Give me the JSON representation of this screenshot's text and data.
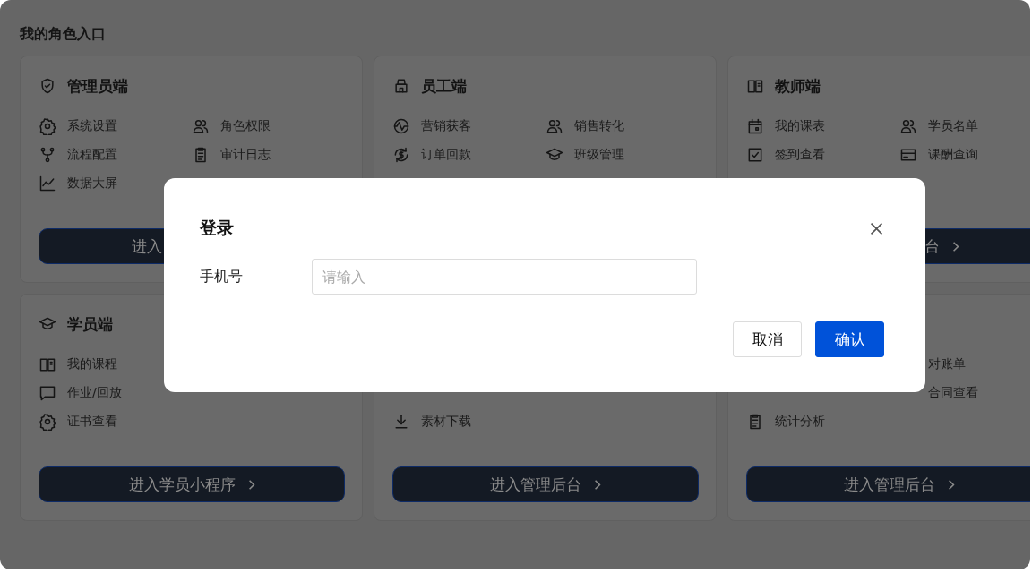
{
  "page_title": "我的角色入口",
  "cards": [
    {
      "title": "管理员端",
      "rows": [
        [
          {
            "label": "系统设置"
          },
          {
            "label": "角色权限"
          }
        ],
        [
          {
            "label": "流程配置"
          },
          {
            "label": "审计日志"
          }
        ],
        [
          {
            "label": "数据大屏"
          },
          null
        ]
      ],
      "button": {
        "label": "进入"
      }
    },
    {
      "title": "员工端",
      "rows": [
        [
          {
            "label": "营销获客"
          },
          {
            "label": "销售转化"
          }
        ],
        [
          {
            "label": "订单回款"
          },
          {
            "label": "班级管理"
          }
        ]
      ]
    },
    {
      "title": "教师端",
      "rows": [
        [
          {
            "label": "我的课表"
          },
          {
            "label": "学员名单"
          }
        ],
        [
          {
            "label": "签到查看"
          },
          {
            "label": "课酬查询"
          }
        ]
      ],
      "button": {
        "label": "台"
      }
    },
    {
      "title": "学员端",
      "rows": [
        [
          {
            "label": "我的课程"
          },
          null
        ],
        [
          {
            "label": "作业/回放"
          },
          null
        ],
        [
          {
            "label": "证书查看"
          },
          null
        ]
      ],
      "button": {
        "label": "进入学员小程序"
      }
    },
    {
      "rows": [
        [
          null,
          null
        ],
        [
          null,
          null
        ],
        [
          {
            "label": "素材下载"
          },
          null
        ]
      ],
      "button": {
        "label": "进入管理后台"
      }
    },
    {
      "rows": [
        [
          null,
          {
            "label": "对账单"
          }
        ],
        [
          null,
          {
            "label": "合同查看"
          }
        ],
        [
          {
            "label": "统计分析"
          },
          null
        ]
      ],
      "button": {
        "label": "进入管理后台"
      }
    }
  ],
  "dialog": {
    "title": "登录",
    "field": {
      "label": "手机号",
      "placeholder": "请输入"
    },
    "buttons": [
      {
        "label": "取消",
        "kind": "secondary"
      },
      {
        "label": "确认",
        "kind": "primary"
      }
    ]
  }
}
